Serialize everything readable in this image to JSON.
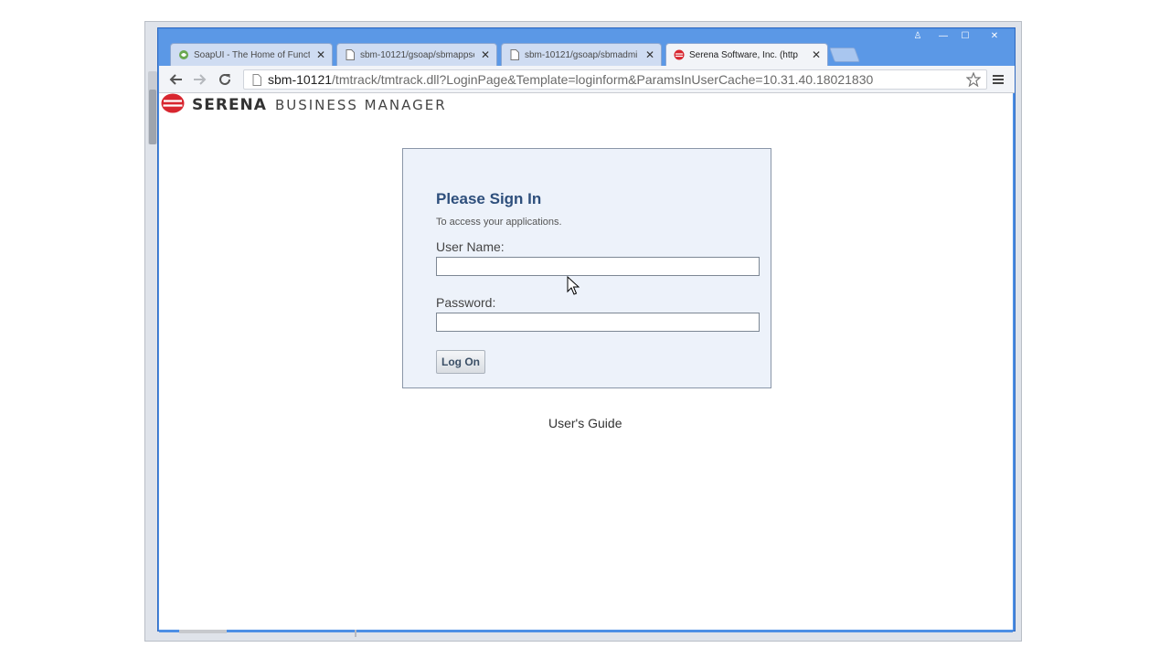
{
  "browser": {
    "tabs": [
      {
        "label": "SoapUI - The Home of Functi",
        "icon": "soapui-icon",
        "active": false
      },
      {
        "label": "sbm-10121/gsoap/sbmappse",
        "icon": "page-icon",
        "active": false
      },
      {
        "label": "sbm-10121/gsoap/sbmadmi",
        "icon": "page-icon",
        "active": false
      },
      {
        "label": "Serena Software, Inc. (http",
        "icon": "serena-icon",
        "active": true
      }
    ],
    "close_glyph": "✕",
    "url_host": "sbm-10121",
    "url_path": "/tmtrack/tmtrack.dll?LoginPage&Template=loginform&ParamsInUserCache=10.31.40.18021830",
    "window_buttons": {
      "user": "♙",
      "minimize": "—",
      "maximize": "☐",
      "close": "✕"
    }
  },
  "brand": {
    "name": "SERENA",
    "subtitle": "BUSINESS MANAGER",
    "logo_color": "#d8262f"
  },
  "login": {
    "title": "Please Sign In",
    "subtitle": "To access your applications.",
    "username_label": "User Name:",
    "username_value": "",
    "password_label": "Password:",
    "password_value": "",
    "submit_label": "Log On"
  },
  "footer": {
    "guide_link": "User's Guide"
  },
  "colors": {
    "chrome_blue": "#4d8fe5",
    "panel_bg": "#edf2fa",
    "title_color": "#2e4f7c"
  }
}
